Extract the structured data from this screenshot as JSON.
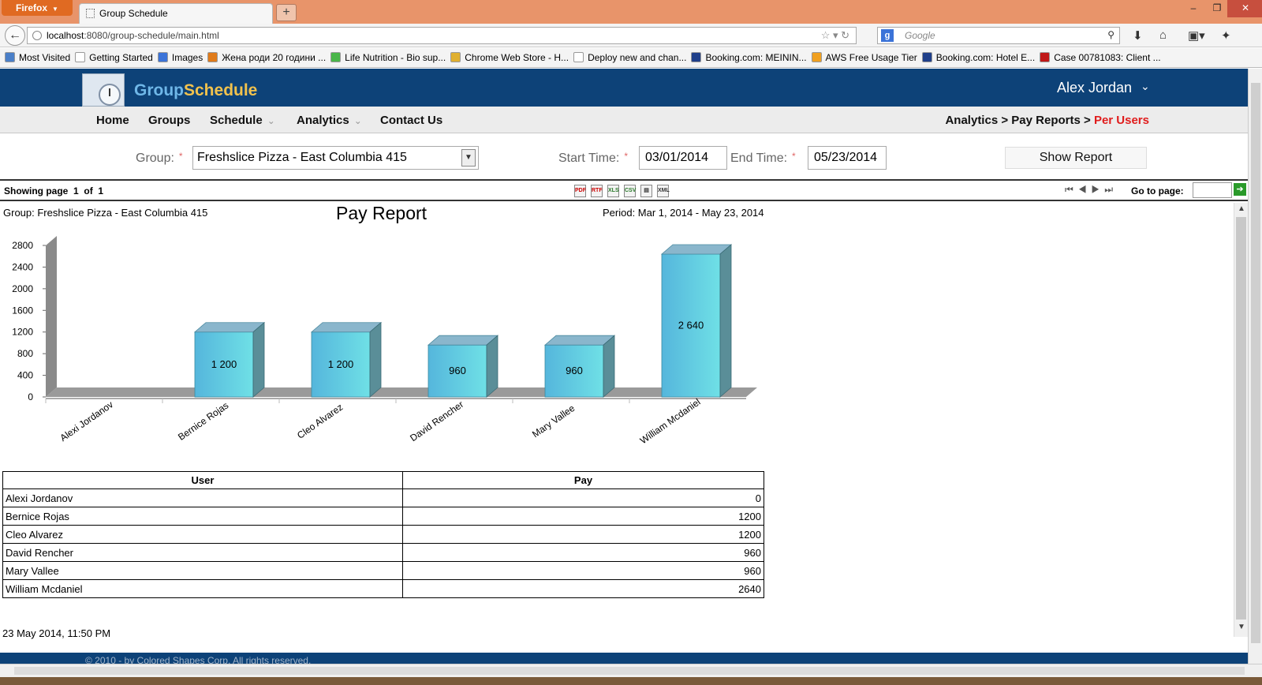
{
  "browser": {
    "app_button": "Firefox",
    "tab_title": "Group Schedule",
    "url_host": "localhost",
    "url_rest": ":8080/group-schedule/main.html",
    "search_placeholder": "Google",
    "bookmarks": [
      {
        "label": "Most Visited",
        "color": "#4a7fc8"
      },
      {
        "label": "Getting Started",
        "color": "#ffffff"
      },
      {
        "label": "Images",
        "color": "#3b73d8"
      },
      {
        "label": "Жена роди 20 години ...",
        "color": "#e07b1a"
      },
      {
        "label": "Life Nutrition - Bio sup...",
        "color": "#49b649"
      },
      {
        "label": "Chrome Web Store - H...",
        "color": "#e0b030"
      },
      {
        "label": "Deploy new and chan...",
        "color": "#ffffff"
      },
      {
        "label": "Booking.com: MEININ...",
        "color": "#1f3f8a"
      },
      {
        "label": "AWS Free Usage Tier",
        "color": "#f0a020"
      },
      {
        "label": "Booking.com: Hotel E...",
        "color": "#1f3f8a"
      },
      {
        "label": "Case 00781083: Client ...",
        "color": "#c01818"
      }
    ]
  },
  "app": {
    "brand_part1": "Group",
    "brand_part2": "Schedule",
    "user_name": "Alex  Jordan",
    "menu": [
      {
        "label": "Home",
        "has_caret": false
      },
      {
        "label": "Groups",
        "has_caret": false
      },
      {
        "label": "Schedule",
        "has_caret": true
      },
      {
        "label": "Analytics",
        "has_caret": true
      },
      {
        "label": "Contact Us",
        "has_caret": false
      }
    ],
    "breadcrumb": {
      "part1": "Analytics",
      "sep": " > ",
      "part2": "Pay Reports",
      "current": "Per Users"
    }
  },
  "filters": {
    "group_label": "Group:",
    "group_value": "Freshslice Pizza - East Columbia 415",
    "start_label": "Start Time:",
    "start_value": "03/01/2014",
    "end_label": "End Time:",
    "end_value": "05/23/2014",
    "required_mark": "*",
    "show_button": "Show Report"
  },
  "viewer": {
    "showing_page": "Showing page",
    "page_current": "1",
    "page_of": "of",
    "page_total": "1",
    "goto_label": "Go to page:"
  },
  "report": {
    "group_line": "Group: Freshslice Pizza - East Columbia 415",
    "title": "Pay Report",
    "period": "Period: Mar 1, 2014 - May 23, 2014",
    "table_headers": [
      "User",
      "Pay"
    ],
    "rows": [
      {
        "user": "Alexi Jordanov",
        "pay": "0"
      },
      {
        "user": "Bernice Rojas",
        "pay": "1200"
      },
      {
        "user": "Cleo Alvarez",
        "pay": "1200"
      },
      {
        "user": "David Rencher",
        "pay": "960"
      },
      {
        "user": "Mary Vallee",
        "pay": "960"
      },
      {
        "user": "William Mcdaniel",
        "pay": "2640"
      }
    ],
    "generated": "23 May 2014, 11:50 PM"
  },
  "footer_text": "© 2010 - by Colored Shapes Corp. All rights reserved.",
  "chart_data": {
    "type": "bar",
    "categories": [
      "Alexi Jordanov",
      "Bernice Rojas",
      "Cleo Alvarez",
      "David Rencher",
      "Mary Vallee",
      "William Mcdaniel"
    ],
    "values": [
      0,
      1200,
      1200,
      960,
      960,
      2640
    ],
    "data_labels": [
      "",
      "1 200",
      "1 200",
      "960",
      "960",
      "2 640"
    ],
    "yticks": [
      "0",
      "400",
      "800",
      "1200",
      "1600",
      "2000",
      "2400",
      "2800"
    ],
    "ylim": [
      0,
      2800
    ],
    "style": "3d",
    "bar_color": "#5cc6df",
    "xlabel": "",
    "ylabel": ""
  }
}
